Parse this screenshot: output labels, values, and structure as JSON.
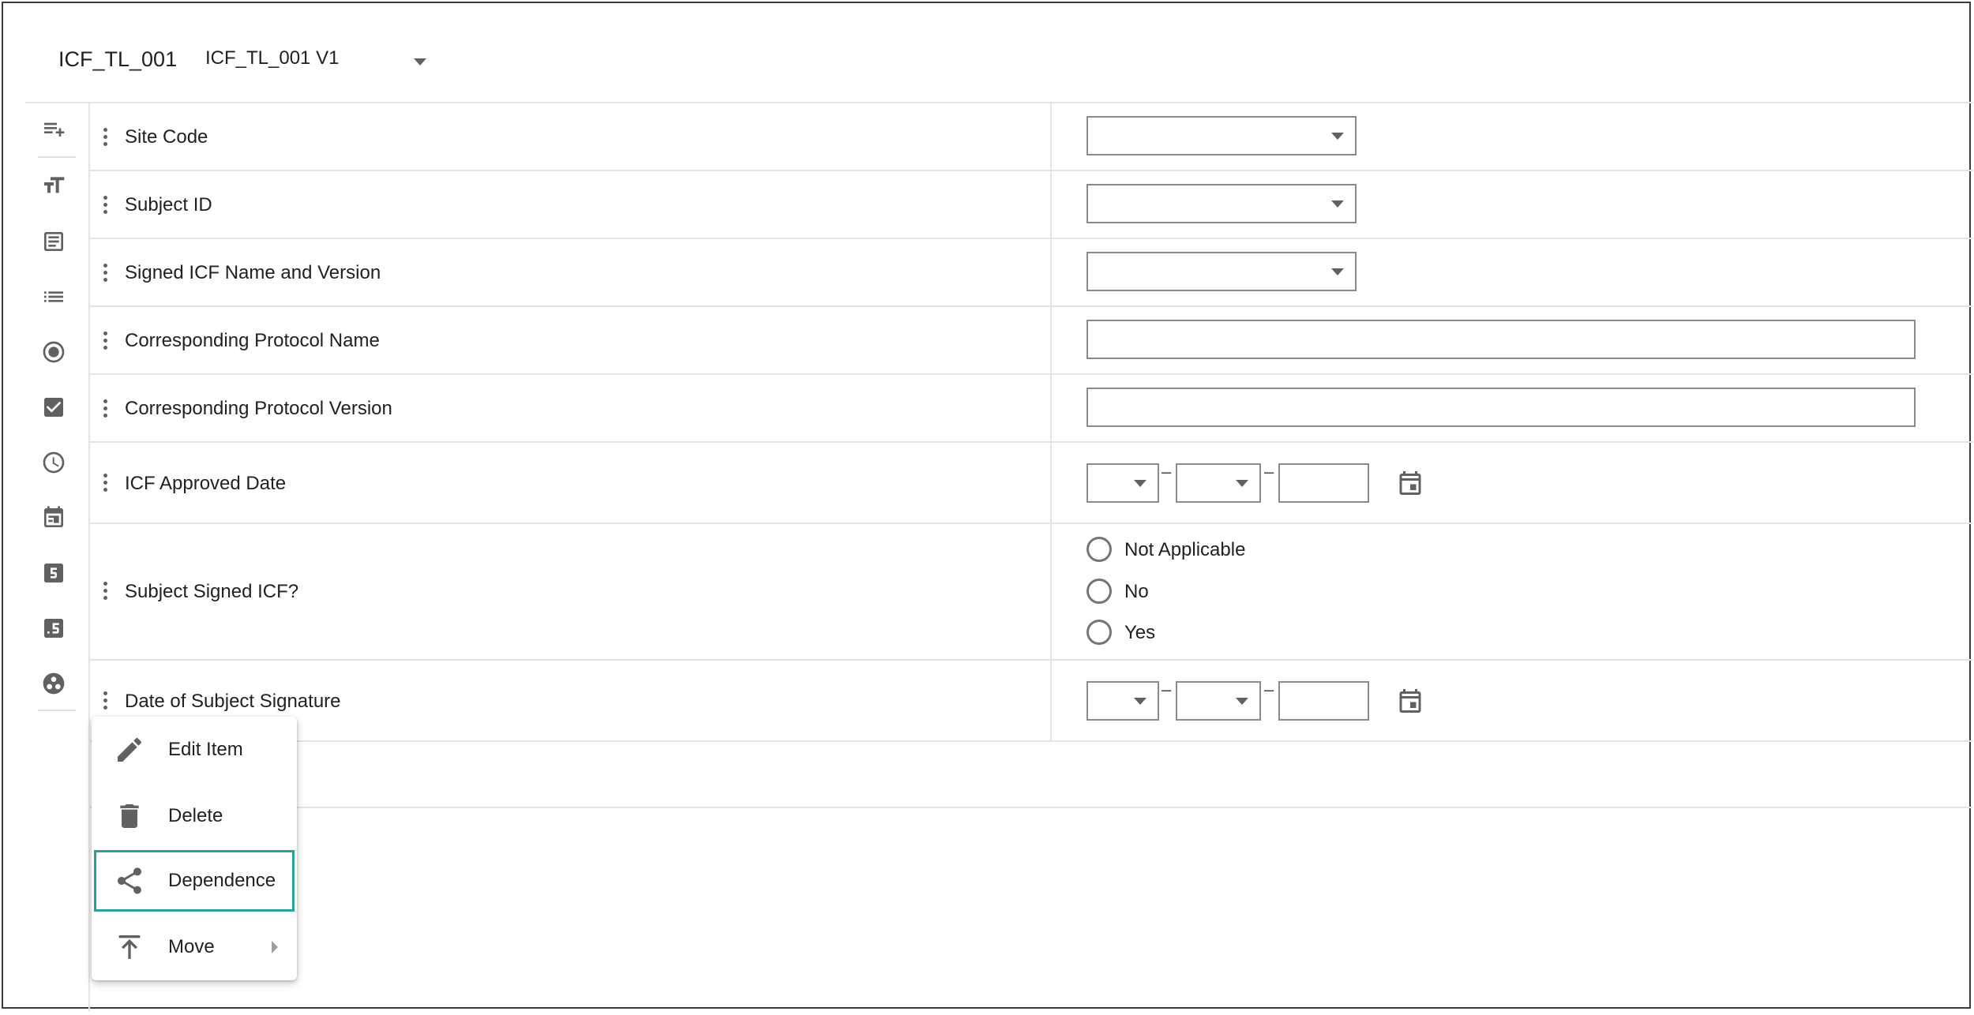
{
  "header": {
    "form_name": "ICF_TL_001",
    "version_selected": "ICF_TL_001 V1"
  },
  "toolbar": {
    "items": [
      {
        "name": "add-item-icon"
      },
      {
        "name": "text-field-icon"
      },
      {
        "name": "textarea-icon"
      },
      {
        "name": "list-icon"
      },
      {
        "name": "radio-icon"
      },
      {
        "name": "checkbox-icon"
      },
      {
        "name": "time-icon"
      },
      {
        "name": "date-icon"
      },
      {
        "name": "integer-icon"
      },
      {
        "name": "decimal-icon"
      },
      {
        "name": "group-icon"
      }
    ]
  },
  "form": {
    "rows": [
      {
        "label": "Site Code",
        "control": "dropdown"
      },
      {
        "label": "Subject ID",
        "control": "dropdown"
      },
      {
        "label": "Signed ICF Name and Version",
        "control": "dropdown"
      },
      {
        "label": "Corresponding Protocol Name",
        "control": "text"
      },
      {
        "label": "Corresponding Protocol Version",
        "control": "text"
      },
      {
        "label": "ICF Approved Date",
        "control": "date",
        "separator": "–"
      },
      {
        "label": "Subject Signed ICF?",
        "control": "radio",
        "options": [
          "Not Applicable",
          "No",
          "Yes"
        ]
      },
      {
        "label": "Date of Subject Signature",
        "control": "date",
        "separator": "–"
      }
    ]
  },
  "context_menu": {
    "items": [
      {
        "label": "Edit Item",
        "icon": "pencil-icon"
      },
      {
        "label": "Delete",
        "icon": "trash-icon"
      },
      {
        "label": "Dependence",
        "icon": "share-icon",
        "highlighted": true
      },
      {
        "label": "Move",
        "icon": "move-top-icon",
        "has_submenu": true
      }
    ]
  },
  "colors": {
    "highlight": "#2aa198",
    "icon": "#616161",
    "border": "#8a8a8a"
  }
}
